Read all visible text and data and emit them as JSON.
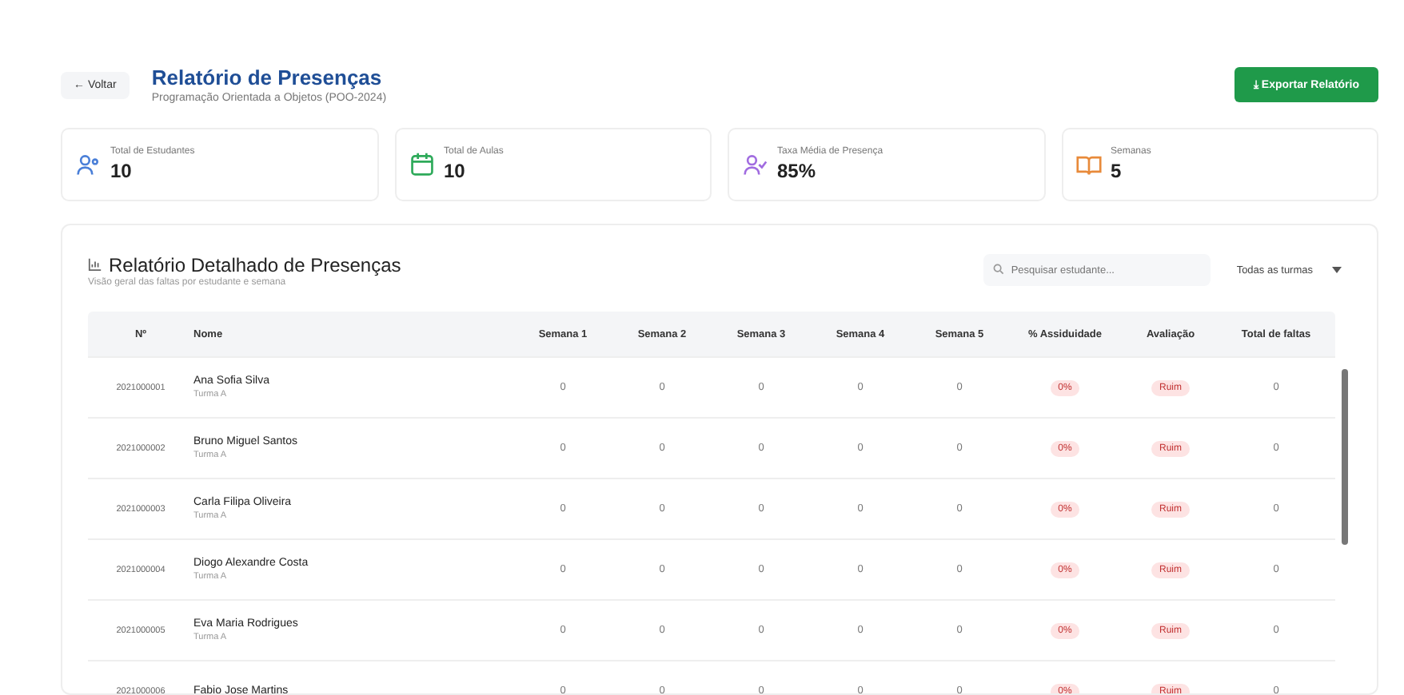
{
  "header": {
    "back_label": "← Voltar",
    "title": "Relatório de Presenças",
    "subtitle": "Programação Orientada a Objetos (POO-2024)",
    "export_label": "⤓ Exportar Relatório"
  },
  "stats": [
    {
      "kind": "students",
      "label": "Total de Estudantes",
      "value": "10"
    },
    {
      "kind": "classes",
      "label": "Total de Aulas",
      "value": "10"
    },
    {
      "kind": "rate",
      "label": "Taxa Média de Presença",
      "value": "85%"
    },
    {
      "kind": "weeks",
      "label": "Semanas",
      "value": "5"
    }
  ],
  "report": {
    "title": "Relatório Detalhado de Presenças",
    "subtitle": "Visão geral das faltas por estudante e semana",
    "search": {
      "placeholder": "Pesquisar estudante..."
    },
    "filter": {
      "value": "Todas as turmas"
    },
    "table": {
      "columns": [
        "Nº",
        "Nome",
        "Semana 1",
        "Semana 2",
        "Semana 3",
        "Semana 4",
        "Semana 5",
        "% Assiduidade",
        "Avaliação",
        "Total de faltas"
      ],
      "rows": [
        {
          "number": "2021000001",
          "name": "Ana Sofia Silva",
          "class": "Turma A",
          "weeks": [
            "0",
            "0",
            "0",
            "0",
            "0"
          ],
          "attendance": "0%",
          "rating": "Ruim",
          "total": "0"
        },
        {
          "number": "2021000002",
          "name": "Bruno Miguel Santos",
          "class": "Turma A",
          "weeks": [
            "0",
            "0",
            "0",
            "0",
            "0"
          ],
          "attendance": "0%",
          "rating": "Ruim",
          "total": "0"
        },
        {
          "number": "2021000003",
          "name": "Carla Filipa Oliveira",
          "class": "Turma A",
          "weeks": [
            "0",
            "0",
            "0",
            "0",
            "0"
          ],
          "attendance": "0%",
          "rating": "Ruim",
          "total": "0"
        },
        {
          "number": "2021000004",
          "name": "Diogo Alexandre Costa",
          "class": "Turma A",
          "weeks": [
            "0",
            "0",
            "0",
            "0",
            "0"
          ],
          "attendance": "0%",
          "rating": "Ruim",
          "total": "0"
        },
        {
          "number": "2021000005",
          "name": "Eva Maria Rodrigues",
          "class": "Turma A",
          "weeks": [
            "0",
            "0",
            "0",
            "0",
            "0"
          ],
          "attendance": "0%",
          "rating": "Ruim",
          "total": "0"
        },
        {
          "number": "2021000006",
          "name": "Fabio Jose Martins",
          "weeks": [
            "0",
            "0",
            "0",
            "0",
            "0"
          ],
          "attendance": "0%",
          "rating": "Ruim",
          "total": "0"
        }
      ]
    }
  }
}
